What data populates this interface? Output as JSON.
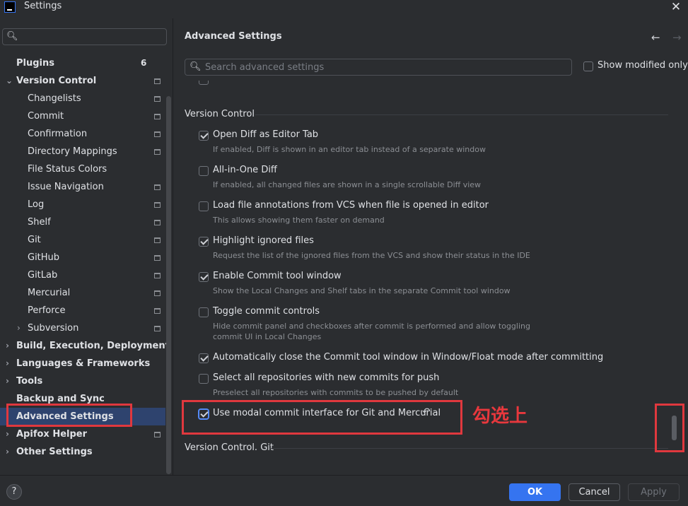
{
  "window": {
    "title": "Settings",
    "close_glyph": "✕"
  },
  "sidebar": {
    "search_placeholder": "",
    "items": [
      {
        "label": "Plugins",
        "badge": "6",
        "level": 0,
        "bold": true,
        "arrow": "",
        "project": false
      },
      {
        "label": "Version Control",
        "level": 0,
        "bold": true,
        "arrow": "⌄",
        "project": true
      },
      {
        "label": "Changelists",
        "level": 1,
        "project": true
      },
      {
        "label": "Commit",
        "level": 1,
        "project": true
      },
      {
        "label": "Confirmation",
        "level": 1,
        "project": true
      },
      {
        "label": "Directory Mappings",
        "level": 1,
        "project": true
      },
      {
        "label": "File Status Colors",
        "level": 1,
        "project": false
      },
      {
        "label": "Issue Navigation",
        "level": 1,
        "project": true
      },
      {
        "label": "Log",
        "level": 1,
        "project": true
      },
      {
        "label": "Shelf",
        "level": 1,
        "project": true
      },
      {
        "label": "Git",
        "level": 1,
        "project": true
      },
      {
        "label": "GitHub",
        "level": 1,
        "project": true
      },
      {
        "label": "GitLab",
        "level": 1,
        "project": true
      },
      {
        "label": "Mercurial",
        "level": 1,
        "project": true
      },
      {
        "label": "Perforce",
        "level": 1,
        "project": true
      },
      {
        "label": "Subversion",
        "level": 1,
        "arrow": "›",
        "project": true
      },
      {
        "label": "Build, Execution, Deployment",
        "level": 0,
        "bold": true,
        "arrow": "›",
        "project": false
      },
      {
        "label": "Languages & Frameworks",
        "level": 0,
        "bold": true,
        "arrow": "›",
        "project": false
      },
      {
        "label": "Tools",
        "level": 0,
        "bold": true,
        "arrow": "›",
        "project": false
      },
      {
        "label": "Backup and Sync",
        "level": 0,
        "bold": true,
        "arrow": "",
        "project": false
      },
      {
        "label": "Advanced Settings",
        "level": 0,
        "bold": true,
        "arrow": "",
        "project": false,
        "selected": true
      },
      {
        "label": "Apifox Helper",
        "level": 0,
        "bold": true,
        "arrow": "›",
        "project": true
      },
      {
        "label": "Other Settings",
        "level": 0,
        "bold": true,
        "arrow": "›",
        "project": false
      }
    ]
  },
  "content": {
    "title": "Advanced Settings",
    "nav_back": "←",
    "nav_forward": "→",
    "search_placeholder": "Search advanced settings",
    "show_modified_label": "Show modified only",
    "section_version_control": "Version Control",
    "section_git": "Version Control. Git",
    "options": [
      {
        "title": "Open Diff as Editor Tab",
        "desc": "If enabled, Diff is shown in an editor tab instead of a separate window",
        "checked": true
      },
      {
        "title": "All-in-One Diff",
        "desc": "If enabled, all changed files are shown in a single scrollable Diff view",
        "checked": false
      },
      {
        "title": "Load file annotations from VCS when file is opened in editor",
        "desc": "This allows showing them faster on demand",
        "checked": false
      },
      {
        "title": "Highlight ignored files",
        "desc": "Request the list of the ignored files from the VCS and show their status in the IDE",
        "checked": true
      },
      {
        "title": "Enable Commit tool window",
        "desc": "Show the Local Changes and Shelf tabs in the separate Commit tool window",
        "checked": true
      },
      {
        "title": "Toggle commit controls",
        "desc": "Hide commit panel and checkboxes after commit is performed and allow toggling commit UI in Local Changes",
        "checked": false
      },
      {
        "title": "Automatically close the Commit tool window in Window/Float mode after committing",
        "desc": "",
        "checked": true
      },
      {
        "title": "Select all repositories with new commits for push",
        "desc": "Preselect all repositories with commits to be pushed by default",
        "checked": false
      },
      {
        "title": "Use modal commit interface for Git and Mercurial",
        "desc": "",
        "checked": true,
        "modified": true
      }
    ],
    "revert_glyph": "↶"
  },
  "annotation": {
    "text": "勾选上",
    "color": "#e8383d"
  },
  "buttons": {
    "ok": "OK",
    "cancel": "Cancel",
    "apply": "Apply",
    "help": "?"
  },
  "colors": {
    "accent": "#3574f0",
    "selection": "#2e436e",
    "highlight": "#e0383e"
  }
}
